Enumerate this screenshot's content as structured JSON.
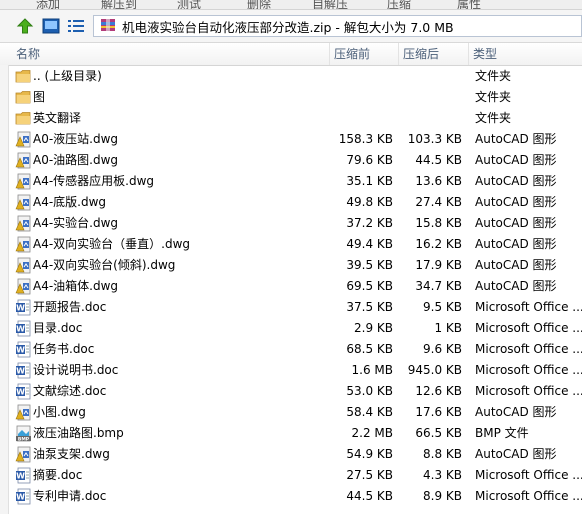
{
  "menu": [
    "添加",
    "解压到",
    "测试",
    "删除",
    "自解压",
    "压缩",
    "属性"
  ],
  "toolbar": {
    "up_icon": "up-arrow-icon",
    "view_icon": "view-icon",
    "details_icon": "details-list-icon"
  },
  "address": {
    "text": "机电液实验台自动化液压部分改造.zip - 解包大小为 7.0 MB"
  },
  "columns": {
    "name": "名称",
    "compressed": "压缩前",
    "size": "压缩后",
    "type": "类型"
  },
  "files": [
    {
      "name": ".. (上级目录)",
      "compressed": "",
      "size": "",
      "type": "文件夹",
      "icon": "folder"
    },
    {
      "name": "图",
      "compressed": "",
      "size": "",
      "type": "文件夹",
      "icon": "folder"
    },
    {
      "name": "英文翻译",
      "compressed": "",
      "size": "",
      "type": "文件夹",
      "icon": "folder"
    },
    {
      "name": "A0-液压站.dwg",
      "compressed": "158.3 KB",
      "size": "103.3 KB",
      "type": "AutoCAD 图形",
      "icon": "dwg"
    },
    {
      "name": "A0-油路图.dwg",
      "compressed": "79.6 KB",
      "size": "44.5 KB",
      "type": "AutoCAD 图形",
      "icon": "dwg"
    },
    {
      "name": "A4-传感器应用板.dwg",
      "compressed": "35.1 KB",
      "size": "13.6 KB",
      "type": "AutoCAD 图形",
      "icon": "dwg"
    },
    {
      "name": "A4-底版.dwg",
      "compressed": "49.8 KB",
      "size": "27.4 KB",
      "type": "AutoCAD 图形",
      "icon": "dwg"
    },
    {
      "name": "A4-实验台.dwg",
      "compressed": "37.2 KB",
      "size": "15.8 KB",
      "type": "AutoCAD 图形",
      "icon": "dwg"
    },
    {
      "name": "A4-双向实验台（垂直）.dwg",
      "compressed": "49.4 KB",
      "size": "16.2 KB",
      "type": "AutoCAD 图形",
      "icon": "dwg"
    },
    {
      "name": "A4-双向实验台(倾斜).dwg",
      "compressed": "39.5 KB",
      "size": "17.9 KB",
      "type": "AutoCAD 图形",
      "icon": "dwg"
    },
    {
      "name": "A4-油箱体.dwg",
      "compressed": "69.5 KB",
      "size": "34.7 KB",
      "type": "AutoCAD 图形",
      "icon": "dwg"
    },
    {
      "name": "开题报告.doc",
      "compressed": "37.5 KB",
      "size": "9.5 KB",
      "type": "Microsoft Office ...",
      "icon": "doc"
    },
    {
      "name": "目录.doc",
      "compressed": "2.9 KB",
      "size": "1 KB",
      "type": "Microsoft Office ...",
      "icon": "doc"
    },
    {
      "name": "任务书.doc",
      "compressed": "68.5 KB",
      "size": "9.6 KB",
      "type": "Microsoft Office ...",
      "icon": "doc"
    },
    {
      "name": "设计说明书.doc",
      "compressed": "1.6 MB",
      "size": "945.0 KB",
      "type": "Microsoft Office ...",
      "icon": "doc"
    },
    {
      "name": "文献综述.doc",
      "compressed": "53.0 KB",
      "size": "12.6 KB",
      "type": "Microsoft Office ...",
      "icon": "doc"
    },
    {
      "name": "小图.dwg",
      "compressed": "58.4 KB",
      "size": "17.6 KB",
      "type": "AutoCAD 图形",
      "icon": "dwg"
    },
    {
      "name": "液压油路图.bmp",
      "compressed": "2.2 MB",
      "size": "66.5 KB",
      "type": "BMP 文件",
      "icon": "bmp"
    },
    {
      "name": "油泵支架.dwg",
      "compressed": "54.9 KB",
      "size": "8.8 KB",
      "type": "AutoCAD 图形",
      "icon": "dwg"
    },
    {
      "name": "摘要.doc",
      "compressed": "27.5 KB",
      "size": "4.3 KB",
      "type": "Microsoft Office ...",
      "icon": "doc"
    },
    {
      "name": "专利申请.doc",
      "compressed": "44.5 KB",
      "size": "8.9 KB",
      "type": "Microsoft Office ...",
      "icon": "doc"
    }
  ]
}
